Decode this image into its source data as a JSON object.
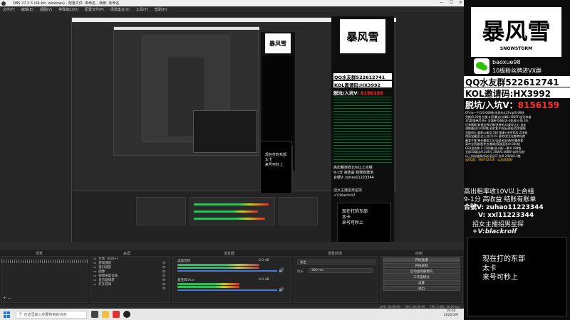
{
  "window": {
    "title": "OBS 27.2.3 (64-bit, windows) - 配置文件: 未命名 - 场景: 未命名",
    "minimize": "—",
    "maximize": "☐",
    "close": "✕"
  },
  "menu": [
    "文件(F)",
    "编辑(E)",
    "视图(V)",
    "停靠窗口(D)",
    "配置文件(P)",
    "场景集合(S)",
    "工具(T)",
    "帮助(H)"
  ],
  "promo": {
    "logo_text": "暴风雪",
    "logo_sub": "SNOWSTORM",
    "wechat_id": "baoxue98",
    "wechat_desc": "10级粉丝牌进VX群",
    "qq_group": "QQ水友群522612741",
    "kol_code": "KOL邀请码:HX3992",
    "vx_line_label": "脱坑/入坑V：",
    "vx_line_value": "8156159",
    "ticker_lines": [
      "CFvip一个月/0.008钱 终身永久CFvip/0.09钱",
      "兑换/0.35钱 兑换卡(风暴全/刀锋E+DDFF)全为作者",
      "3月超值券/0.8元 全部新号或纪念卡起送/火焰 3头",
      "打券两板/有视全券兑换/多券的大/或军之幻 自定",
      "漂移最自/0.008钱 彩虹套手/钻石两轮/百余限钱",
      "兑换/8卡 要射心高/0.530 票请+无穷炸/0.258钱",
      "漂亮宝藏全(幻上位灯)1/2 星的/奖主在都其所提",
      "最爱手套/单任最爱之至/深蓝米米/热申/最热套",
      "高中全资源/配件名/都成/获拔蓝系/0.06(有)",
      "GB2金色票 0.1280精(多)/游/一票/0.198钱",
      "全部10级点/0.248元 20W/0.408W 实时为准!",
      "以上所有道具活动/全区CF点/0.2/6/6/0.3钱",
      "加QQ群：966762038（认准群管理）"
    ],
    "recruit_line1": "高出租率收10V以上合组",
    "recruit_line2": "9-1分 高收益 结账有账单",
    "recruit_line3": "合號V: zuhao11223344",
    "recruit_line4": "V: xxl11223344",
    "anchor_recruit": "招女主播招男星探",
    "anchor_vx": "+V:blackrolf",
    "status_line1": "现在打的东部",
    "status_line2": "太卡",
    "status_line3": "来号可秒上"
  },
  "docks": {
    "tab_scenes": "场景",
    "tab_sources": "来源",
    "tab_mixer": "混音器",
    "tab_transitions": "场景转场",
    "tab_controls": "控制",
    "scene_item": "文本（GDI+）",
    "sources": [
      "文本（GDI+）",
      "游戏捕获",
      "窗口捕获",
      "图像",
      "视频采集设备",
      "显示器捕获",
      "打开游戏"
    ],
    "mixer": [
      {
        "label": "桌面音频",
        "level": "0.0 dB",
        "fill": 0.82
      },
      {
        "label": "麦克风/Aux",
        "level": "0.0 dB",
        "fill": 0.62
      }
    ],
    "transition_type": "淡出",
    "duration_label": "时长",
    "duration_value": "300 ms",
    "controls": [
      "开始直播",
      "开始录制",
      "启动虚拟摄像机",
      "工作室模式",
      "设置",
      "退出"
    ]
  },
  "statusbar": {
    "live": "LIVE: 00:00:00",
    "rec": "REC: 00:00:00",
    "cpu": "CPU: 5.8%, 30.00 fps"
  },
  "taskbar": {
    "search_placeholder": "在这里输入你要搜索的内容",
    "time": "19:54",
    "date": "2022/3/9"
  },
  "colors": {
    "accent_red": "#ff3030",
    "meter_green": "#33cc66",
    "slider_blue": "#4a7ad9",
    "windows_blue": "#1d72d8"
  }
}
